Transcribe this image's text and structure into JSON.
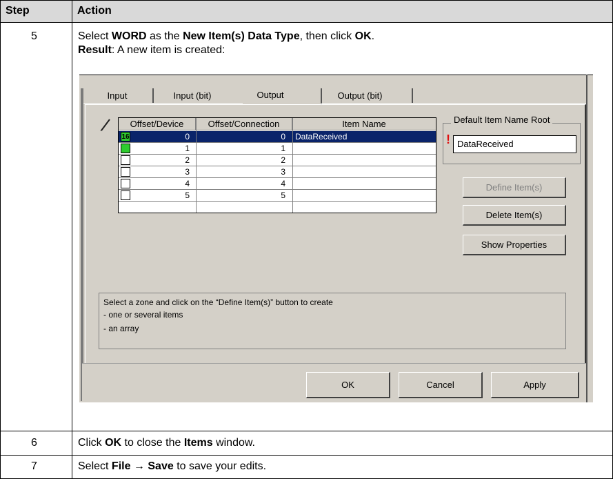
{
  "table": {
    "headers": {
      "step": "Step",
      "action": "Action"
    },
    "rows": [
      {
        "step": "5",
        "line1_parts": [
          "Select ",
          "WORD",
          " as the ",
          "New Item(s) Data Type",
          ", then click ",
          "OK",
          "."
        ],
        "line2_parts": [
          "Result",
          ": A new item is created:"
        ]
      },
      {
        "step": "6",
        "parts": [
          "Click ",
          "OK",
          " to close the ",
          "Items",
          " window."
        ]
      },
      {
        "step": "7",
        "parts": [
          "Select ",
          "File",
          " → ",
          "Save",
          " to save your edits."
        ]
      }
    ]
  },
  "dialog": {
    "tabs": [
      "Input",
      "Input (bit)",
      "Output",
      "Output (bit)"
    ],
    "active_tab": "Output",
    "grid": {
      "columns": [
        "Offset/Device",
        "Offset/Connection",
        "Item Name"
      ],
      "rows": [
        {
          "device": "0",
          "connection": "0",
          "name": "DataReceived",
          "marker": "16"
        },
        {
          "device": "1",
          "connection": "1",
          "name": ""
        },
        {
          "device": "2",
          "connection": "2",
          "name": ""
        },
        {
          "device": "3",
          "connection": "3",
          "name": ""
        },
        {
          "device": "4",
          "connection": "4",
          "name": ""
        },
        {
          "device": "5",
          "connection": "5",
          "name": ""
        }
      ]
    },
    "default_root": {
      "label": "Default Item Name Root",
      "value": "DataReceived",
      "warning": "!"
    },
    "buttons": {
      "define": "Define Item(s)",
      "delete": "Delete Item(s)",
      "show": "Show Properties"
    },
    "message": [
      "Select a zone and click on the “Define Item(s)” button to create",
      "- one or several items",
      "- an array"
    ],
    "footer": {
      "ok": "OK",
      "cancel": "Cancel",
      "apply": "Apply"
    }
  }
}
